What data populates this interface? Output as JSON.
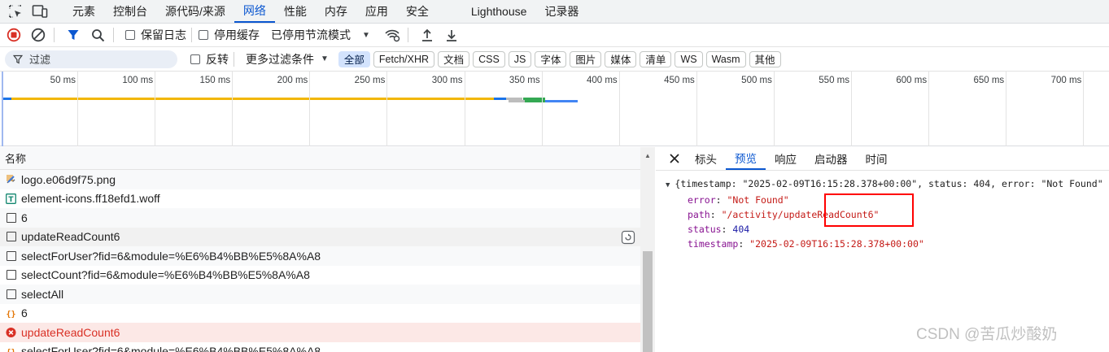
{
  "topbar": {
    "tabs": [
      {
        "label": "元素",
        "active": false
      },
      {
        "label": "控制台",
        "active": false
      },
      {
        "label": "源代码/来源",
        "active": false
      },
      {
        "label": "网络",
        "active": true
      },
      {
        "label": "性能",
        "active": false
      },
      {
        "label": "内存",
        "active": false
      },
      {
        "label": "应用",
        "active": false
      },
      {
        "label": "安全",
        "active": false
      },
      {
        "label": "Lighthouse",
        "active": false
      },
      {
        "label": "记录器",
        "active": false
      }
    ]
  },
  "toolbar": {
    "preserve_log": "保留日志",
    "disable_cache": "停用缓存",
    "throttling": "已停用节流模式"
  },
  "filter": {
    "placeholder": "过滤",
    "invert": "反转",
    "more_filters": "更多过滤条件",
    "types": [
      {
        "label": "全部",
        "active": true
      },
      {
        "label": "Fetch/XHR",
        "active": false
      },
      {
        "label": "文档",
        "active": false
      },
      {
        "label": "CSS",
        "active": false
      },
      {
        "label": "JS",
        "active": false
      },
      {
        "label": "字体",
        "active": false
      },
      {
        "label": "图片",
        "active": false
      },
      {
        "label": "媒体",
        "active": false
      },
      {
        "label": "清单",
        "active": false
      },
      {
        "label": "WS",
        "active": false
      },
      {
        "label": "Wasm",
        "active": false
      },
      {
        "label": "其他",
        "active": false
      }
    ]
  },
  "overview": {
    "ticks": [
      "50 ms",
      "100 ms",
      "150 ms",
      "200 ms",
      "250 ms",
      "300 ms",
      "350 ms",
      "400 ms",
      "450 ms",
      "500 ms",
      "550 ms",
      "600 ms",
      "650 ms",
      "700 ms"
    ]
  },
  "requests": {
    "column_name": "名称",
    "rows": [
      {
        "name": "logo.e06d9f75.png",
        "type": "image"
      },
      {
        "name": "element-icons.ff18efd1.woff",
        "type": "font"
      },
      {
        "name": "6",
        "type": "doc"
      },
      {
        "name": "updateReadCount6",
        "type": "doc"
      },
      {
        "name": "selectForUser?fid=6&module=%E6%B4%BB%E5%8A%A8",
        "type": "doc"
      },
      {
        "name": "selectCount?fid=6&module=%E6%B4%BB%E5%8A%A8",
        "type": "doc"
      },
      {
        "name": "selectAll",
        "type": "doc"
      },
      {
        "name": "6",
        "type": "json"
      },
      {
        "name": "updateReadCount6",
        "type": "error"
      },
      {
        "name": "selectForUser?fid=6&module=%E6%B4%BB%E5%8A%A8",
        "type": "json"
      }
    ]
  },
  "detail": {
    "tabs": [
      {
        "label": "标头",
        "active": false
      },
      {
        "label": "预览",
        "active": true
      },
      {
        "label": "响应",
        "active": false
      },
      {
        "label": "启动器",
        "active": false
      },
      {
        "label": "时间",
        "active": false
      }
    ],
    "summary": "{timestamp: \"2025-02-09T16:15:28.378+00:00\", status: 404, error: \"Not Found\"",
    "props": [
      {
        "key": "error",
        "value": "\"Not Found\"",
        "kind": "string"
      },
      {
        "key": "path",
        "value": "\"/activity/updateReadCount6\"",
        "kind": "string"
      },
      {
        "key": "status",
        "value": "404",
        "kind": "number"
      },
      {
        "key": "timestamp",
        "value": "\"2025-02-09T16:15:28.378+00:00\"",
        "kind": "string"
      }
    ]
  },
  "watermark": "CSDN @苦瓜炒酸奶",
  "colors": {
    "accent": "#0b57d0",
    "error_text": "#d93025",
    "error_bg": "#fce8e6",
    "highlight_box": "#ff0000"
  }
}
